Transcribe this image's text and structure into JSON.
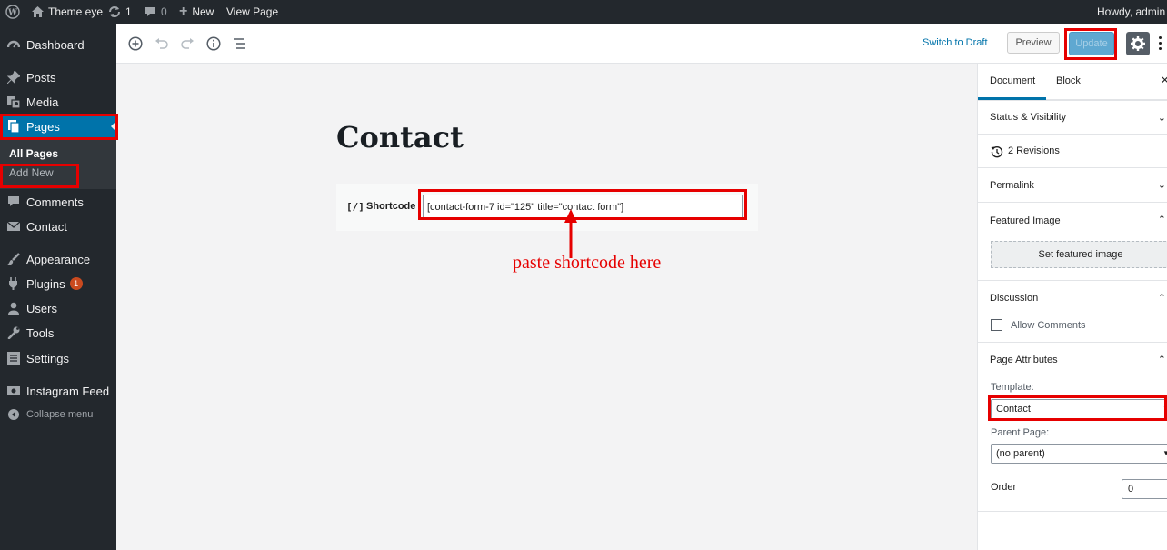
{
  "admin_bar": {
    "site_name": "Theme eye",
    "updates_count": "1",
    "comments_count": "0",
    "new_label": "New",
    "view_page_label": "View Page",
    "greeting": "Howdy, admin"
  },
  "sidebar": {
    "dashboard": "Dashboard",
    "posts": "Posts",
    "media": "Media",
    "pages": "Pages",
    "all_pages": "All Pages",
    "add_new": "Add New",
    "comments": "Comments",
    "contact": "Contact",
    "appearance": "Appearance",
    "plugins": "Plugins",
    "plugins_badge": "1",
    "users": "Users",
    "tools": "Tools",
    "settings": "Settings",
    "instagram_feed": "Instagram Feed",
    "collapse_menu": "Collapse menu"
  },
  "toolbar": {
    "switch_to_draft": "Switch to Draft",
    "preview": "Preview",
    "update": "Update"
  },
  "editor": {
    "page_title": "Contact",
    "block_icon": "[/]",
    "block_label": "Shortcode",
    "shortcode_value": "[contact-form-7 id=\"125\" title=\"contact form\"]",
    "annotation": "paste shortcode here"
  },
  "panel": {
    "tab_document": "Document",
    "tab_block": "Block",
    "status_visibility": "Status & Visibility",
    "revisions": "2 Revisions",
    "permalink": "Permalink",
    "featured_image": "Featured Image",
    "set_featured_image": "Set featured image",
    "discussion": "Discussion",
    "allow_comments": "Allow Comments",
    "page_attributes": "Page Attributes",
    "template_label": "Template:",
    "template_value": "Contact",
    "parent_label": "Parent Page:",
    "parent_value": "(no parent)",
    "order_label": "Order",
    "order_value": "0"
  },
  "colors": {
    "admin_bg": "#23282d",
    "accent": "#0073aa",
    "highlight": "#e60000"
  }
}
